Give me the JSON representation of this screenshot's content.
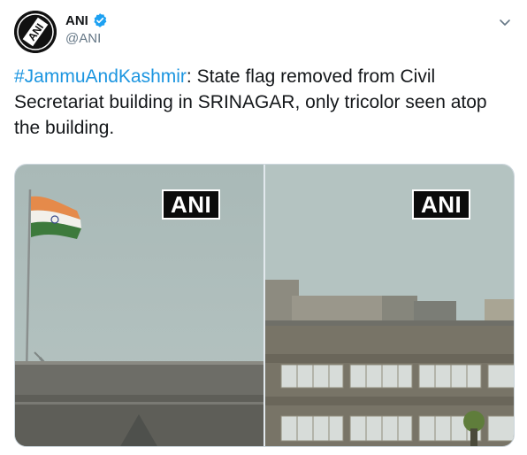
{
  "author": {
    "display_name": "ANI",
    "handle": "@ANI",
    "verified_icon": "verified-badge-icon",
    "avatar_text": "ANI"
  },
  "tweet": {
    "hashtag": "#JammuAndKashmir",
    "body": ": State flag removed from Civil Secretariat building in SRINAGAR, only tricolor seen atop the building."
  },
  "media": {
    "left_watermark": "ANI",
    "right_watermark": "ANI"
  },
  "colors": {
    "link": "#1b95e0",
    "verified": "#1da1f2",
    "muted": "#657786"
  }
}
